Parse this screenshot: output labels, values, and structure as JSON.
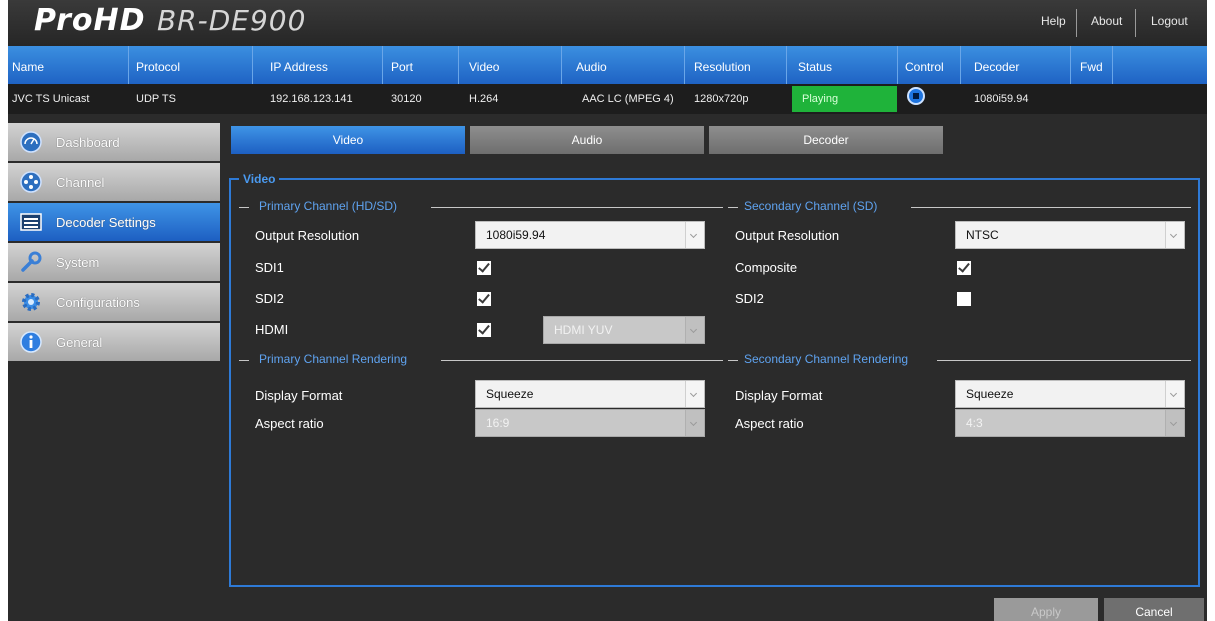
{
  "header": {
    "brand": "ProHD",
    "model": "BR-DE900",
    "links": [
      "Help",
      "About",
      "Logout"
    ]
  },
  "stream_table": {
    "columns": [
      "Name",
      "Protocol",
      "IP Address",
      "Port",
      "Video",
      "Audio",
      "Resolution",
      "Status",
      "Control",
      "Decoder",
      "Fwd"
    ],
    "row": {
      "name": "JVC TS Unicast",
      "protocol": "UDP TS",
      "ip": "192.168.123.141",
      "port": "30120",
      "video": "H.264",
      "audio": "AAC LC (MPEG 4)",
      "resolution": "1280x720p",
      "status": "Playing",
      "decoder": "1080i59.94"
    }
  },
  "sidebar": {
    "items": [
      {
        "label": "Dashboard",
        "icon": "dashboard-icon"
      },
      {
        "label": "Channel",
        "icon": "channel-icon"
      },
      {
        "label": "Decoder Settings",
        "icon": "decoder-settings-icon"
      },
      {
        "label": "System",
        "icon": "wrench-icon"
      },
      {
        "label": "Configurations",
        "icon": "gear-icon"
      },
      {
        "label": "General",
        "icon": "info-icon"
      }
    ],
    "active_index": 2
  },
  "tabs": [
    {
      "label": "Video",
      "active": true
    },
    {
      "label": "Audio",
      "active": false
    },
    {
      "label": "Decoder",
      "active": false
    }
  ],
  "video_panel": {
    "section_title": "Video",
    "primary_channel": {
      "title": "Primary Channel (HD/SD)",
      "output_resolution_label": "Output Resolution",
      "output_resolution_value": "1080i59.94",
      "sdi1_label": "SDI1",
      "sdi1_checked": true,
      "sdi2_label": "SDI2",
      "sdi2_checked": true,
      "hdmi_label": "HDMI",
      "hdmi_checked": true,
      "hdmi_mode": "HDMI YUV"
    },
    "secondary_channel": {
      "title": "Secondary Channel (SD)",
      "output_resolution_label": "Output Resolution",
      "output_resolution_value": "NTSC",
      "composite_label": "Composite",
      "composite_checked": true,
      "sdi2_label": "SDI2",
      "sdi2_checked": false
    },
    "primary_rendering": {
      "title": "Primary Channel Rendering",
      "display_format_label": "Display Format",
      "display_format_value": "Squeeze",
      "aspect_ratio_label": "Aspect ratio",
      "aspect_ratio_value": "16:9"
    },
    "secondary_rendering": {
      "title": "Secondary Channel Rendering",
      "display_format_label": "Display Format",
      "display_format_value": "Squeeze",
      "aspect_ratio_label": "Aspect ratio",
      "aspect_ratio_value": "4:3"
    }
  },
  "footer": {
    "apply_label": "Apply",
    "cancel_label": "Cancel"
  },
  "colors": {
    "accent_blue": "#1f6fd6",
    "status_green": "#1fb33a",
    "background": "#2b2b2b"
  }
}
